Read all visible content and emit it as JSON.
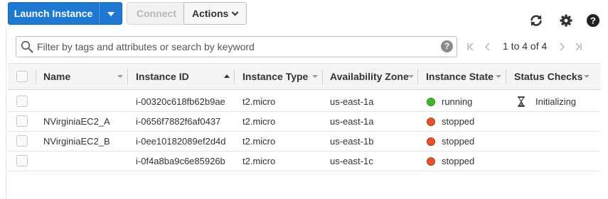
{
  "toolbar": {
    "launch_label": "Launch Instance",
    "connect_label": "Connect",
    "actions_label": "Actions"
  },
  "search": {
    "placeholder": "Filter by tags and attributes or search by keyword",
    "help": "?"
  },
  "pagination": {
    "text": "1 to 4 of 4"
  },
  "table": {
    "columns": [
      "Name",
      "Instance ID",
      "Instance Type",
      "Availability Zone",
      "Instance State",
      "Status Checks"
    ],
    "sorted_column": "Instance ID",
    "rows": [
      {
        "name": "",
        "id": "i-00320c618fb62b9ae",
        "type": "t2.micro",
        "zone": "us-east-1a",
        "state": "running",
        "status": "Initializing"
      },
      {
        "name": "NVirginiaEC2_A",
        "id": "i-0656f7882f6af0437",
        "type": "t2.micro",
        "zone": "us-east-1a",
        "state": "stopped",
        "status": ""
      },
      {
        "name": "NVirginiaEC2_B",
        "id": "i-0ee10182089ef2d4d",
        "type": "t2.micro",
        "zone": "us-east-1b",
        "state": "stopped",
        "status": ""
      },
      {
        "name": "",
        "id": "i-0f4a8ba9c6e85926b",
        "type": "t2.micro",
        "zone": "us-east-1c",
        "state": "stopped",
        "status": ""
      }
    ]
  },
  "colors": {
    "primary": "#1f78d1",
    "running": "#41b626",
    "stopped": "#e5532f"
  },
  "icons": [
    "refresh-icon",
    "gear-icon",
    "help-icon",
    "search-icon",
    "first-page-icon",
    "prev-page-icon",
    "next-page-icon",
    "last-page-icon",
    "hourglass-icon"
  ]
}
